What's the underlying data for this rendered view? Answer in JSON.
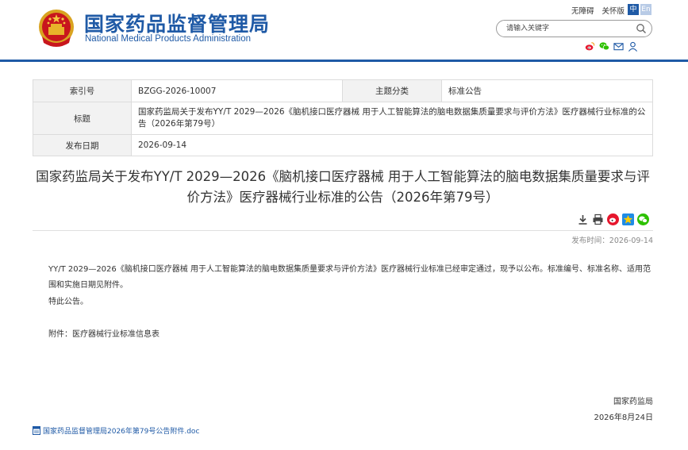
{
  "header": {
    "site_name_cn": "国家药品监督管理局",
    "site_name_en": "National Medical Products Administration",
    "accessibility_link": "无障碍",
    "elder_link": "关怀版",
    "lang_zh": "中",
    "lang_en": "En",
    "search_placeholder": "请输入关键字",
    "brand_color": "#1f5aa6"
  },
  "info": {
    "index_label": "索引号",
    "index_value": "BZGG-2026-10007",
    "category_label": "主题分类",
    "category_value": "标准公告",
    "title_label": "标题",
    "title_value": "国家药监局关于发布YY/T 2029—2026《脑机接口医疗器械 用于人工智能算法的脑电数据集质量要求与评价方法》医疗器械行业标准的公告（2026年第79号）",
    "date_label": "发布日期",
    "date_value": "2026-09-14"
  },
  "article": {
    "title": "国家药监局关于发布YY/T 2029—2026《脑机接口医疗器械 用于人工智能算法的脑电数据集质量要求与评价方法》医疗器械行业标准的公告（2026年第79号）",
    "pubdate": "发布时间：2026-09-14",
    "paragraph1": "YY/T 2029—2026《脑机接口医疗器械 用于人工智能算法的脑电数据集质量要求与评价方法》医疗器械行业标准已经审定通过，现予以公布。标准编号、标准名称、适用范围和实施日期见附件。",
    "paragraph2": "特此公告。",
    "attachment_note": "附件：医疗器械行业标准信息表",
    "signer": "国家药监局",
    "sign_date": "2026年8月24日",
    "attachment_file": "国家药品监督管理局2026年第79号公告附件.doc"
  },
  "icons": [
    "national-emblem-icon",
    "search-icon",
    "weibo-icon",
    "wechat-icon",
    "mail-icon",
    "user-icon",
    "download-icon",
    "print-icon",
    "star-icon",
    "doc-file-icon"
  ]
}
